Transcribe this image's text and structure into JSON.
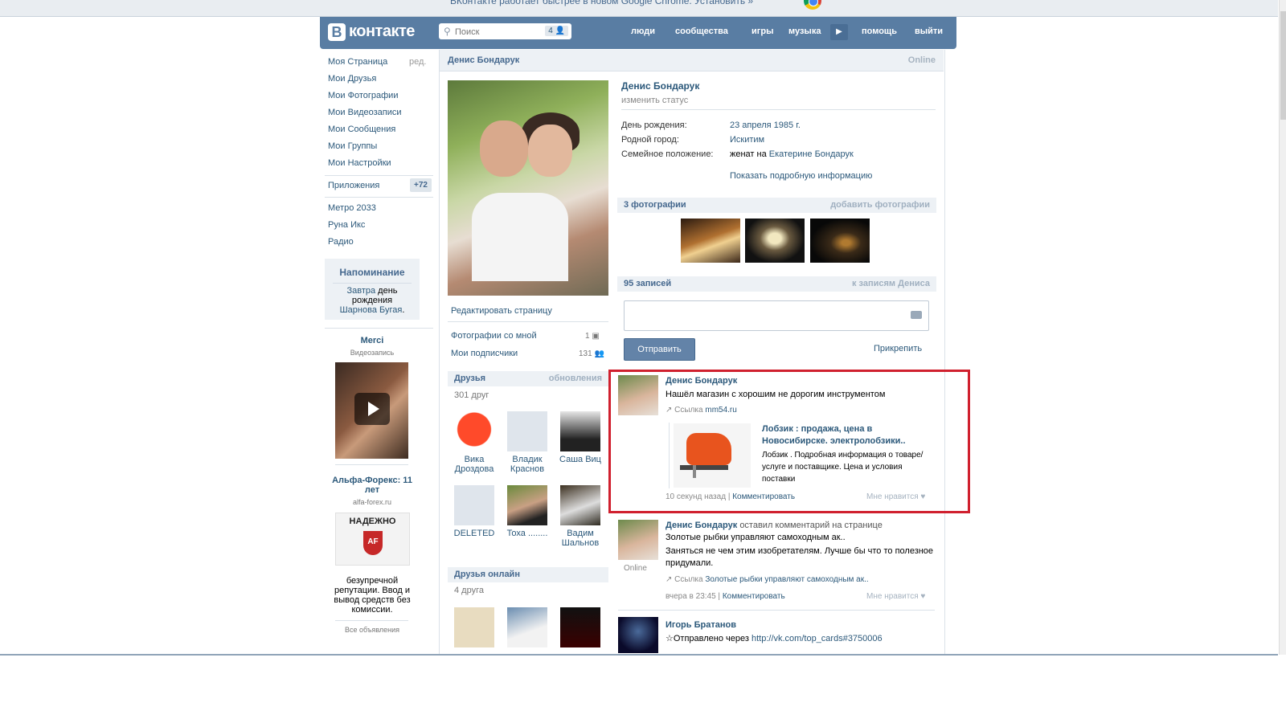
{
  "banner": {
    "text": "ВКонтакте работает быстрее в новом Google Chrome. Установить »"
  },
  "header": {
    "logo_b": "В",
    "logo_text": "контакте",
    "search_placeholder": "Поиск",
    "search_count": "4",
    "nav": [
      "люди",
      "сообщества",
      "игры",
      "музыка",
      "помощь",
      "выйти"
    ]
  },
  "left_menu": {
    "items": [
      "Моя Страница",
      "Мои Друзья",
      "Мои Фотографии",
      "Мои Видеозаписи",
      "Мои Сообщения",
      "Мои Группы",
      "Мои Настройки"
    ],
    "edit": "ред.",
    "apps": "Приложения",
    "apps_badge": "+72",
    "app_items": [
      "Метро 2033",
      "Руна Икс",
      "Радио"
    ]
  },
  "reminder": {
    "title": "Напоминание",
    "text_1": "Завтра",
    "text_2": "день рождения",
    "name": "Шарнова Бугая",
    "text_end": "."
  },
  "ads": {
    "ad1_title": "Merci",
    "ad1_sub": "Видеозапись",
    "ad2_title": "Альфа-Форекс: 11 лет",
    "ad2_sub": "alfa-forex.ru",
    "ad2_logo_text": "НАДЕЖНО",
    "ad2_text": "безупречной репутации. Ввод и вывод средств без комиссии.",
    "all": "Все объявления"
  },
  "profile": {
    "name": "Денис Бондарук",
    "online": "Online",
    "change_status": "изменить статус",
    "birthday_label": "День рождения:",
    "birthday": "23 апреля 1985 г.",
    "hometown_label": "Родной город:",
    "hometown": "Искитим",
    "family_label": "Семейное положение:",
    "family_prefix": "женат на",
    "family_person": "Екатерине Бондарук",
    "show_more": "Показать подробную информацию",
    "edit_page": "Редактировать страницу",
    "photos_with_me": "Фотографии со мной",
    "photos_with_me_count": "1",
    "subscribers": "Мои подписчики",
    "subscribers_count": "131"
  },
  "friends": {
    "title": "Друзья",
    "updates": "обновления",
    "count": "301 друг",
    "list": [
      {
        "name": "Вика Дроздова"
      },
      {
        "name": "Владик Краснов"
      },
      {
        "name": "Саша Виц"
      },
      {
        "name": "DELETED"
      },
      {
        "name": "Тоха ........"
      },
      {
        "name": "Вадим Шальнов"
      }
    ],
    "online_title": "Друзья онлайн",
    "online_count": "4 друга"
  },
  "photos": {
    "title": "3 фотографии",
    "add": "добавить фотографии"
  },
  "wall": {
    "title": "95 записей",
    "to_posts": "к записям Дениса",
    "send": "Отправить",
    "attach": "Прикрепить"
  },
  "posts": [
    {
      "author": "Денис Бондарук",
      "text": "Нашёл магазин с хорошим не дорогим инструментом",
      "link_label": "Ссылка",
      "link": "mm54.ru",
      "snippet_title": "Лобзик : продажа, цена в Новосибирске. электролобзики..",
      "snippet_text": "Лобзик . Подробная информация о товаре/услуге и поставщике. Цена и условия поставки",
      "time": "10 секунд назад",
      "comment": "Комментировать",
      "like": "Мне нравится"
    },
    {
      "author": "Денис Бондарук",
      "action": "оставил комментарий на странице",
      "target": "Золотые рыбки управляют самоходным ак..",
      "text": "Заняться не чем этим изобретателям. Лучше бы что то полезное придумали.",
      "link_label": "Ссылка",
      "link": "Золотые рыбки управляют самоходным ак..",
      "online": "Online",
      "time": "вчера в 23:45",
      "comment": "Комментировать",
      "like": "Мне нравится"
    },
    {
      "author": "Игорь Братанов",
      "text_prefix": "☆Отправлено через",
      "link": "http://vk.com/top_cards#3750006"
    }
  ]
}
